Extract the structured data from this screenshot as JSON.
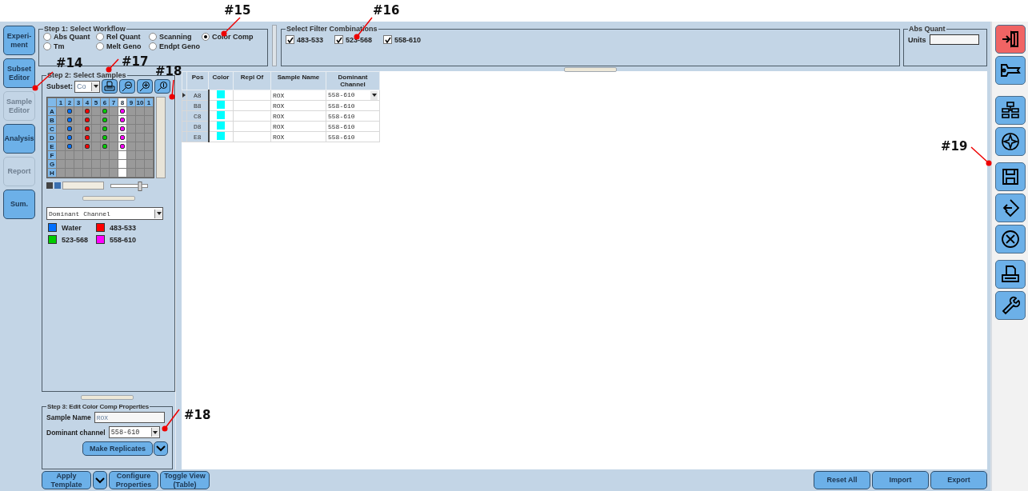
{
  "nav": [
    {
      "label": "Experi-\nment",
      "disabled": false
    },
    {
      "label": "Subset\nEditor",
      "disabled": false
    },
    {
      "label": "Sample\nEditor",
      "disabled": true
    },
    {
      "label": "Analysis",
      "disabled": false
    },
    {
      "label": "Report",
      "disabled": true
    },
    {
      "label": "Sum.",
      "disabled": false
    }
  ],
  "step1": {
    "title": "Step 1: Select Workflow",
    "options": [
      {
        "label": "Abs Quant",
        "selected": false
      },
      {
        "label": "Rel Quant",
        "selected": false
      },
      {
        "label": "Scanning",
        "selected": false
      },
      {
        "label": "Color Comp",
        "selected": true
      },
      {
        "label": "Tm",
        "selected": false
      },
      {
        "label": "Melt Geno",
        "selected": false
      },
      {
        "label": "Endpt Geno",
        "selected": false
      }
    ]
  },
  "filters": {
    "title": "Select Filter Combinations",
    "items": [
      {
        "label": "483-533",
        "checked": true
      },
      {
        "label": "523-568",
        "checked": true
      },
      {
        "label": "558-610",
        "checked": true
      }
    ]
  },
  "abs_quant": {
    "title": "Abs Quant",
    "units_label": "Units"
  },
  "step2": {
    "title": "Step 2: Select Samples",
    "subset_label": "Subset:",
    "subset_value": "Co",
    "plate": {
      "columns": [
        {
          "label": "1",
          "selected": false
        },
        {
          "label": "2",
          "selected": false
        },
        {
          "label": "3",
          "selected": false
        },
        {
          "label": "4",
          "selected": false
        },
        {
          "label": "5",
          "selected": false
        },
        {
          "label": "6",
          "selected": false
        },
        {
          "label": "7",
          "selected": false
        },
        {
          "label": "8",
          "selected": true
        },
        {
          "label": "9",
          "selected": false
        },
        {
          "label": "10",
          "selected": false
        },
        {
          "label": "1",
          "selected": false
        }
      ],
      "rows": [
        {
          "label": "A",
          "wells": [
            {
              "kind": "empty"
            },
            {
              "kind": "sample",
              "color": "#0070ff"
            },
            {
              "kind": "empty"
            },
            {
              "kind": "sample",
              "color": "#ff0000"
            },
            {
              "kind": "empty"
            },
            {
              "kind": "sample",
              "color": "#00cc00"
            },
            {
              "kind": "empty"
            },
            {
              "kind": "sample",
              "color": "#ff00ff"
            },
            {
              "kind": "empty"
            },
            {
              "kind": "empty"
            },
            {
              "kind": "empty"
            }
          ]
        },
        {
          "label": "B",
          "wells": [
            {
              "kind": "empty"
            },
            {
              "kind": "sample",
              "color": "#0070ff"
            },
            {
              "kind": "empty"
            },
            {
              "kind": "sample",
              "color": "#ff0000"
            },
            {
              "kind": "empty"
            },
            {
              "kind": "sample",
              "color": "#00cc00"
            },
            {
              "kind": "empty"
            },
            {
              "kind": "sample",
              "color": "#ff00ff"
            },
            {
              "kind": "empty"
            },
            {
              "kind": "empty"
            },
            {
              "kind": "empty"
            }
          ]
        },
        {
          "label": "C",
          "wells": [
            {
              "kind": "empty"
            },
            {
              "kind": "sample",
              "color": "#0070ff"
            },
            {
              "kind": "empty"
            },
            {
              "kind": "sample",
              "color": "#ff0000"
            },
            {
              "kind": "empty"
            },
            {
              "kind": "sample",
              "color": "#00cc00"
            },
            {
              "kind": "empty"
            },
            {
              "kind": "sample",
              "color": "#ff00ff"
            },
            {
              "kind": "empty"
            },
            {
              "kind": "empty"
            },
            {
              "kind": "empty"
            }
          ]
        },
        {
          "label": "D",
          "wells": [
            {
              "kind": "empty"
            },
            {
              "kind": "sample",
              "color": "#0070ff"
            },
            {
              "kind": "empty"
            },
            {
              "kind": "sample",
              "color": "#ff0000"
            },
            {
              "kind": "empty"
            },
            {
              "kind": "sample",
              "color": "#00cc00"
            },
            {
              "kind": "empty"
            },
            {
              "kind": "sample",
              "color": "#ff00ff"
            },
            {
              "kind": "empty"
            },
            {
              "kind": "empty"
            },
            {
              "kind": "empty"
            }
          ]
        },
        {
          "label": "E",
          "wells": [
            {
              "kind": "empty"
            },
            {
              "kind": "sample",
              "color": "#0070ff"
            },
            {
              "kind": "empty"
            },
            {
              "kind": "sample",
              "color": "#ff0000"
            },
            {
              "kind": "empty"
            },
            {
              "kind": "sample",
              "color": "#00cc00"
            },
            {
              "kind": "empty"
            },
            {
              "kind": "sample",
              "color": "#ff00ff"
            },
            {
              "kind": "empty"
            },
            {
              "kind": "empty"
            },
            {
              "kind": "empty"
            }
          ]
        },
        {
          "label": "F",
          "wells": [
            {
              "kind": "empty"
            },
            {
              "kind": "empty"
            },
            {
              "kind": "empty"
            },
            {
              "kind": "empty"
            },
            {
              "kind": "empty"
            },
            {
              "kind": "empty"
            },
            {
              "kind": "empty"
            },
            {
              "kind": "empty"
            },
            {
              "kind": "empty"
            },
            {
              "kind": "empty"
            },
            {
              "kind": "empty"
            }
          ]
        },
        {
          "label": "G",
          "wells": [
            {
              "kind": "empty"
            },
            {
              "kind": "empty"
            },
            {
              "kind": "empty"
            },
            {
              "kind": "empty"
            },
            {
              "kind": "empty"
            },
            {
              "kind": "empty"
            },
            {
              "kind": "empty"
            },
            {
              "kind": "empty"
            },
            {
              "kind": "empty"
            },
            {
              "kind": "empty"
            },
            {
              "kind": "empty"
            }
          ]
        },
        {
          "label": "H",
          "wells": [
            {
              "kind": "empty"
            },
            {
              "kind": "empty"
            },
            {
              "kind": "empty"
            },
            {
              "kind": "empty"
            },
            {
              "kind": "empty"
            },
            {
              "kind": "empty"
            },
            {
              "kind": "empty"
            },
            {
              "kind": "empty"
            },
            {
              "kind": "empty"
            },
            {
              "kind": "empty"
            },
            {
              "kind": "empty"
            }
          ]
        }
      ]
    },
    "zoom_slider": {
      "level": 0.8
    },
    "view_select": "Dominant Channel",
    "legend": [
      {
        "label": "Water",
        "color": "#0070ff"
      },
      {
        "label": "483-533",
        "color": "#ff0000"
      },
      {
        "label": "523-568",
        "color": "#00cc00"
      },
      {
        "label": "558-610",
        "color": "#ff00ff"
      }
    ]
  },
  "step3": {
    "title": "Step 3: Edit Color Comp Properties",
    "sample_name_label": "Sample Name",
    "sample_name": "ROX",
    "channel_label": "Dominant channel",
    "channel": "558-610",
    "replicates_button": "Make Replicates"
  },
  "table": {
    "columns": [
      "Pos",
      "Color",
      "Repl Of",
      "Sample Name",
      "Dominant\nChannel"
    ],
    "rows": [
      {
        "pos": "A8",
        "color": "#00ffff",
        "sample_name": "ROX",
        "channel": "558-610",
        "selected": true
      },
      {
        "pos": "B8",
        "color": "#00ffff",
        "sample_name": "ROX",
        "channel": "558-610",
        "selected": false
      },
      {
        "pos": "C8",
        "color": "#00ffff",
        "sample_name": "ROX",
        "channel": "558-610",
        "selected": false
      },
      {
        "pos": "D8",
        "color": "#00ffff",
        "sample_name": "ROX",
        "channel": "558-610",
        "selected": false
      },
      {
        "pos": "E8",
        "color": "#00ffff",
        "sample_name": "ROX",
        "channel": "558-610",
        "selected": false
      }
    ]
  },
  "bottom_left": [
    "Apply\nTemplate",
    "Configure\nProperties",
    "Toggle View\n(Table)"
  ],
  "bottom_right": [
    "Reset All",
    "Import",
    "Export"
  ],
  "annotations": [
    "#15",
    "#16",
    "#14",
    "#17",
    "#18",
    "#18",
    "#19"
  ]
}
